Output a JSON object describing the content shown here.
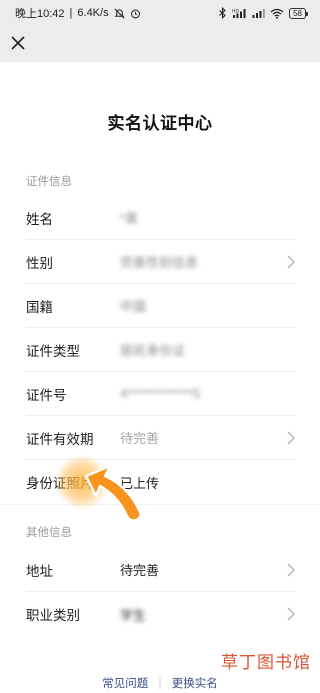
{
  "status_bar": {
    "time": "晚上10:42",
    "net_speed": "6.4K/s",
    "battery": "58",
    "icons": [
      "mute-icon",
      "alarm-icon",
      "bluetooth-icon",
      "hd-signal-icon",
      "signal-icon",
      "wifi-icon",
      "battery-icon"
    ]
  },
  "header": {
    "close_icon": "close-icon"
  },
  "page": {
    "title": "实名认证中心"
  },
  "sections": {
    "id_info": "证件信息",
    "other_info": "其他信息"
  },
  "rows": {
    "name": {
      "label": "姓名",
      "value": "*昊"
    },
    "gender": {
      "label": "性别",
      "value": "完善性别信息"
    },
    "nationality": {
      "label": "国籍",
      "value": "中国"
    },
    "id_type": {
      "label": "证件类型",
      "value": "居民身份证"
    },
    "id_number": {
      "label": "证件号",
      "value": "4*************5"
    },
    "id_validity": {
      "label": "证件有效期",
      "value": "待完善"
    },
    "id_photo": {
      "label": "身份证照片",
      "value": "已上传"
    },
    "address": {
      "label": "地址",
      "value": "待完善"
    },
    "occupation": {
      "label": "职业类别",
      "value": "学生"
    }
  },
  "footer": {
    "faq": "常见问题",
    "separator": "|",
    "change_name": "更换实名"
  },
  "watermark": "草丁图书馆",
  "colors": {
    "accent_link": "#3a4f8a",
    "watermark": "#d94c2a",
    "pointer": "#f7941d"
  }
}
